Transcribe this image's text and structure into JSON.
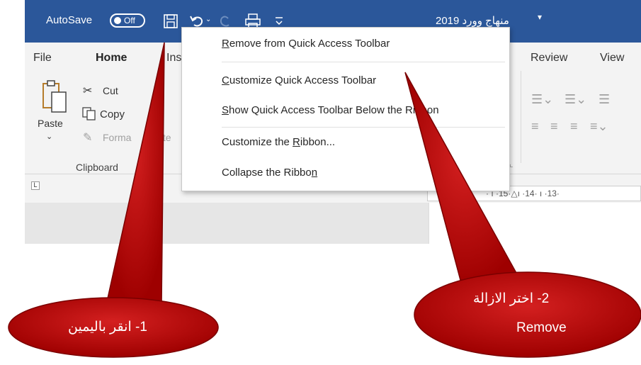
{
  "titlebar": {
    "autosave_label": "AutoSave",
    "autosave_state": "Off",
    "document_title": "منهاج وورد 2019",
    "title_dropdown": "▾",
    "bg_color": "#2b579a"
  },
  "ribbon": {
    "tabs": [
      "File",
      "Home",
      "Inse",
      "Review",
      "View"
    ],
    "clipboard": {
      "paste_label": "Paste",
      "cut_label": "Cut",
      "copy_label": "Copy",
      "format_label": "Forma",
      "format_tail": "inte",
      "group_label": "Clipboard"
    }
  },
  "ruler": {
    "corner": "L",
    "ticks": "· ı ·15·△ı ·14· ı ·13·"
  },
  "context_menu": {
    "items": [
      {
        "text": "Remove from Quick Access Toolbar",
        "accel": "R"
      },
      {
        "text": "Customize Quick Access Toolbar",
        "accel": "C"
      },
      {
        "text": "Show Quick Access Toolbar Below the Ribbon",
        "accel": "S"
      },
      {
        "text": "Customize the Ribbon...",
        "accel": "R"
      },
      {
        "text": "Collapse the Ribbon",
        "accel": "n"
      }
    ]
  },
  "callouts": {
    "one": "1- انقر باليمين",
    "two_line1": "2- اختر الازالة",
    "two_line2": "Remove",
    "fill": "#c00000"
  }
}
